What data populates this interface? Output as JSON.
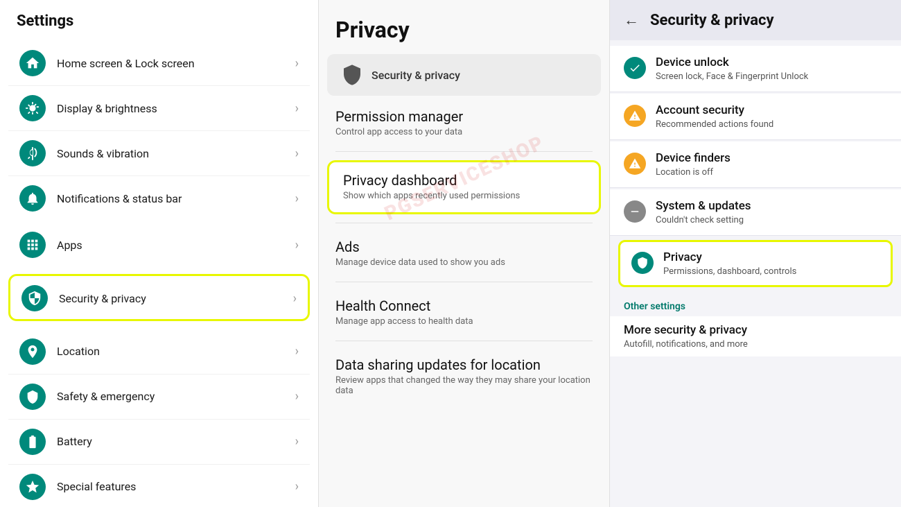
{
  "left": {
    "title": "Settings",
    "groups": [
      {
        "highlighted": false,
        "items": [
          {
            "label": "Home screen & Lock screen",
            "icon": "home",
            "color": "#00897B"
          },
          {
            "label": "Display & brightness",
            "icon": "brightness",
            "color": "#00897B"
          },
          {
            "label": "Sounds & vibration",
            "icon": "sound",
            "color": "#00897B"
          },
          {
            "label": "Notifications & status bar",
            "icon": "notification",
            "color": "#00897B"
          }
        ]
      },
      {
        "highlighted": false,
        "items": [
          {
            "label": "Apps",
            "icon": "apps",
            "color": "#00897B"
          }
        ]
      },
      {
        "highlighted": true,
        "items": [
          {
            "label": "Security & privacy",
            "icon": "security",
            "color": "#00897B"
          }
        ]
      },
      {
        "highlighted": false,
        "items": [
          {
            "label": "Location",
            "icon": "location",
            "color": "#00897B"
          },
          {
            "label": "Safety & emergency",
            "icon": "safety",
            "color": "#00897B"
          },
          {
            "label": "Battery",
            "icon": "battery",
            "color": "#00897B"
          },
          {
            "label": "Special features",
            "icon": "star",
            "color": "#00897B"
          }
        ]
      }
    ]
  },
  "middle": {
    "title": "Privacy",
    "section_header": {
      "label": "Security & privacy"
    },
    "items": [
      {
        "title": "Permission manager",
        "subtitle": "Control app access to your data",
        "highlighted": false
      },
      {
        "title": "Privacy dashboard",
        "subtitle": "Show which apps recently used permissions",
        "highlighted": true
      },
      {
        "title": "Ads",
        "subtitle": "Manage device data used to show you ads",
        "highlighted": false
      },
      {
        "title": "Health Connect",
        "subtitle": "Manage app access to health data",
        "highlighted": false
      },
      {
        "title": "Data sharing updates for location",
        "subtitle": "Review apps that changed the way they may share your location data",
        "highlighted": false
      }
    ]
  },
  "right": {
    "header_title": "Security & privacy",
    "items": [
      {
        "title": "Device unlock",
        "subtitle": "Screen lock, Face & Fingerprint Unlock",
        "status": "green",
        "icon_type": "check"
      },
      {
        "title": "Account security",
        "subtitle": "Recommended actions found",
        "status": "orange",
        "icon_type": "warning"
      },
      {
        "title": "Device finders",
        "subtitle": "Location is off",
        "status": "orange",
        "icon_type": "warning"
      },
      {
        "title": "System & updates",
        "subtitle": "Couldn't check setting",
        "status": "gray",
        "icon_type": "minus"
      }
    ],
    "highlighted_item": {
      "title": "Privacy",
      "subtitle": "Permissions, dashboard, controls",
      "icon_type": "shield"
    },
    "other_settings_label": "Other settings",
    "more_item": {
      "title": "More security & privacy",
      "subtitle": "Autofill, notifications, and more"
    }
  },
  "watermark": {
    "text": "PGSERVICESHOP"
  }
}
